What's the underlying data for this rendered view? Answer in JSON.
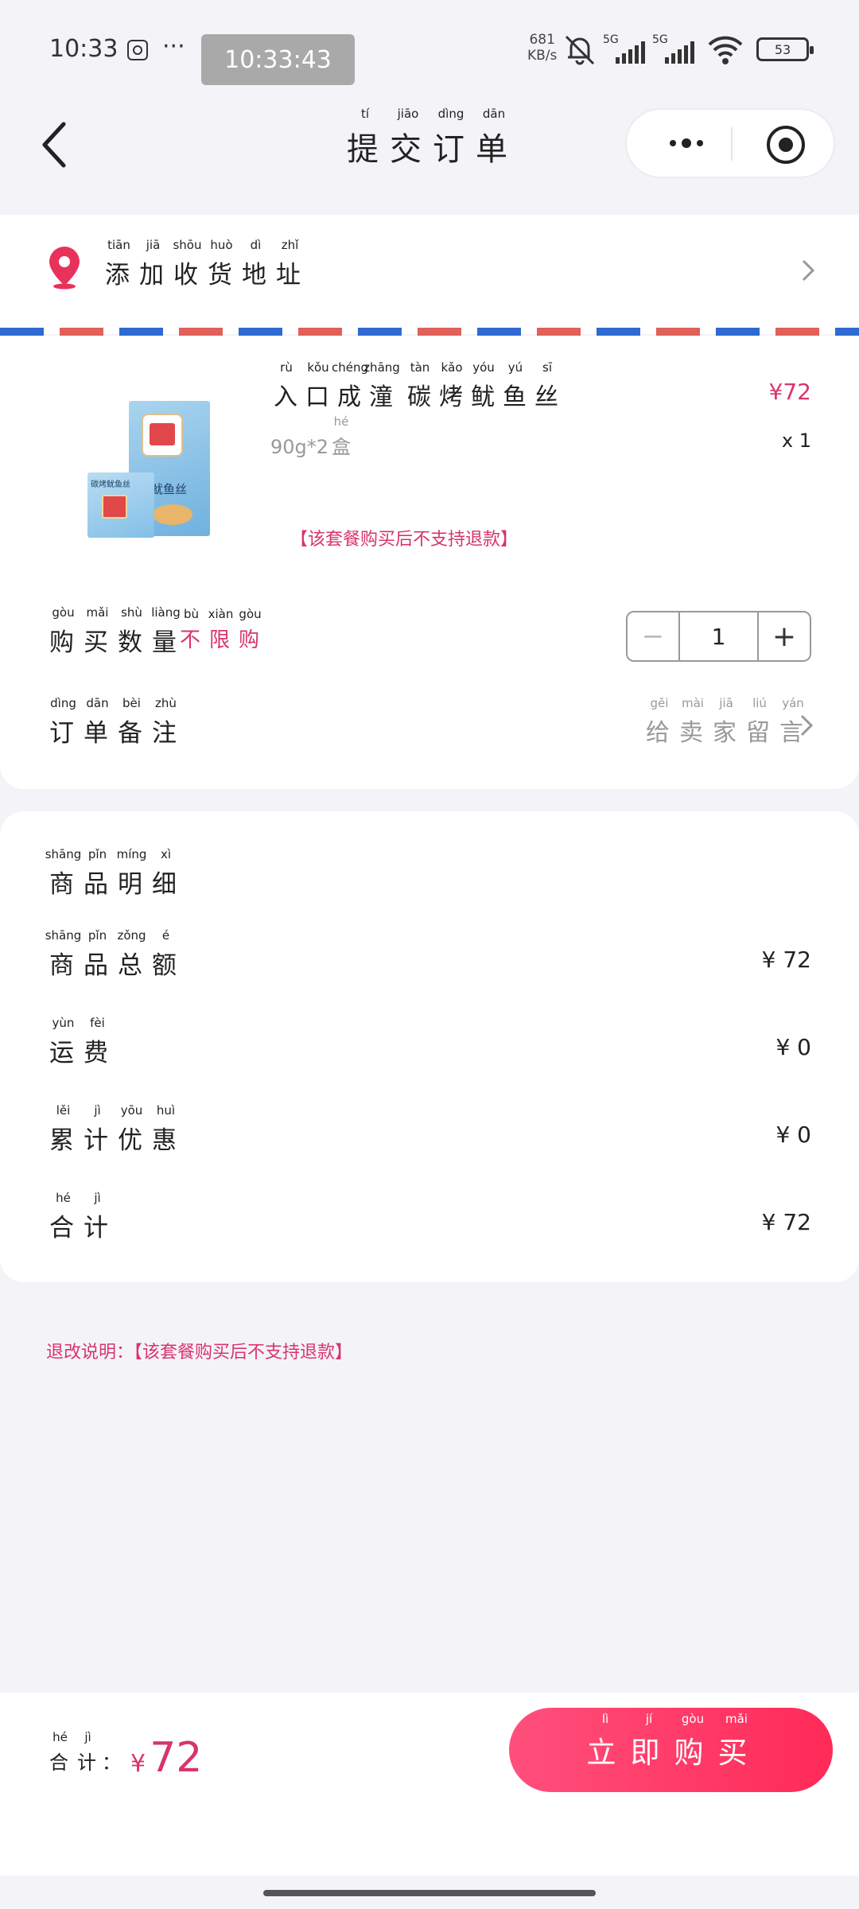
{
  "status_bar": {
    "time": "10:33",
    "clock_chip": "10:33:43",
    "net_speed_value": "681",
    "net_speed_unit": "KB/s",
    "signal_1": "5G",
    "signal_2": "5G",
    "battery": "53"
  },
  "nav": {
    "title_chars": [
      "提",
      "交",
      "订",
      "单"
    ],
    "title_pinyin": [
      "tí",
      "jiāo",
      "dìng",
      "dān"
    ]
  },
  "address": {
    "chars": [
      "添",
      "加",
      "收",
      "货",
      "地",
      "址"
    ],
    "pinyin": [
      "tiān",
      "jiā",
      "shōu",
      "huò",
      "dì",
      "zhǐ"
    ]
  },
  "product": {
    "name_chars": [
      "入",
      "口",
      "成",
      "潼",
      " ",
      "碳",
      "烤",
      "鱿",
      "鱼",
      "丝"
    ],
    "name_pinyin": [
      "rù",
      "kǒu",
      "chéng",
      "zhāng",
      "",
      "tàn",
      "kǎo",
      "yóu",
      "yú",
      "sī"
    ],
    "spec_text": "90g*2",
    "spec_char": "盒",
    "spec_pinyin": "hé",
    "price": "¥72",
    "quantity": "x 1",
    "notice": "【该套餐购买后不支持退款】",
    "box_label": "鱿鱼丝",
    "box_label_2": "碳烤鱿鱼丝"
  },
  "qty_row": {
    "label_chars": [
      "购",
      "买",
      "数",
      "量"
    ],
    "label_pinyin": [
      "gòu",
      "mǎi",
      "shù",
      "liàng"
    ],
    "limit_chars": [
      "不",
      "限",
      "购"
    ],
    "limit_pinyin": [
      "bù",
      "xiàn",
      "gòu"
    ],
    "value": "1",
    "minus": "−",
    "plus": "+"
  },
  "note_row": {
    "label_chars": [
      "订",
      "单",
      "备",
      "注"
    ],
    "label_pinyin": [
      "dìng",
      "dān",
      "bèi",
      "zhù"
    ],
    "placeholder_chars": [
      "给",
      "卖",
      "家",
      "留",
      "言"
    ],
    "placeholder_pinyin": [
      "gěi",
      "mài",
      "jiā",
      "liú",
      "yán"
    ]
  },
  "details": {
    "title_chars": [
      "商",
      "品",
      "明",
      "细"
    ],
    "title_pinyin": [
      "shāng",
      "pǐn",
      "míng",
      "xì"
    ],
    "rows": [
      {
        "chars": [
          "商",
          "品",
          "总",
          "额"
        ],
        "pinyin": [
          "shāng",
          "pǐn",
          "zǒng",
          "é"
        ],
        "value": "¥ 72"
      },
      {
        "chars": [
          "运",
          "费"
        ],
        "pinyin": [
          "yùn",
          "fèi"
        ],
        "value": "¥ 0"
      },
      {
        "chars": [
          "累",
          "计",
          "优",
          "惠"
        ],
        "pinyin": [
          "lěi",
          "jì",
          "yōu",
          "huì"
        ],
        "value": "¥ 0"
      },
      {
        "chars": [
          "合",
          "计"
        ],
        "pinyin": [
          "hé",
          "jì"
        ],
        "value": "¥ 72"
      }
    ]
  },
  "refund_note": "退改说明：【该套餐购买后不支持退款】",
  "footer": {
    "total_chars": [
      "合",
      "计"
    ],
    "total_pinyin": [
      "hé",
      "jì"
    ],
    "total_colon": "：",
    "currency": "¥",
    "amount": "72",
    "buy_chars": [
      "立",
      "即",
      "购",
      "买"
    ],
    "buy_pinyin": [
      "lì",
      "jí",
      "gòu",
      "mǎi"
    ]
  },
  "colors": {
    "accent_pink": "#d8346b",
    "buy_gradient_start": "#ff4f7c",
    "buy_gradient_end": "#ff2a58",
    "background": "#f4f4f8"
  }
}
